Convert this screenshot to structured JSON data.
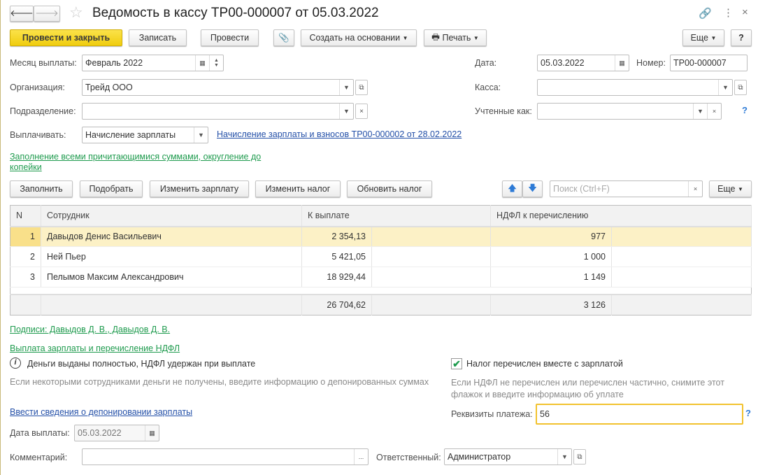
{
  "window": {
    "title": "Ведомость в кассу ТР00-000007 от 05.03.2022"
  },
  "toolbar": {
    "post_close": "Провести и закрыть",
    "save": "Записать",
    "post": "Провести",
    "create_based": "Создать на основании",
    "print": "Печать",
    "more": "Еще",
    "help": "?"
  },
  "form": {
    "month_label": "Месяц выплаты:",
    "month_value": "Февраль 2022",
    "date_label": "Дата:",
    "date_value": "05.03.2022",
    "number_label": "Номер:",
    "number_value": "ТР00-000007",
    "org_label": "Организация:",
    "org_value": "Трейд ООО",
    "cash_label": "Касса:",
    "cash_value": "",
    "dept_label": "Подразделение:",
    "dept_value": "",
    "accounted_label": "Учтенные как:",
    "accounted_value": "",
    "pay_label": "Выплачивать:",
    "pay_value": "Начисление зарплаты",
    "pay_link": "Начисление зарплаты и взносов ТР00-000002 от 28.02.2022",
    "fill_link": "Заполнение всеми причитающимися суммами, округление до копейки"
  },
  "table_toolbar": {
    "fill": "Заполнить",
    "pick": "Подобрать",
    "change_salary": "Изменить зарплату",
    "change_tax": "Изменить налог",
    "update_tax": "Обновить налог",
    "search_placeholder": "Поиск (Ctrl+F)",
    "more": "Еще"
  },
  "table": {
    "headers": [
      "N",
      "Сотрудник",
      "К выплате",
      "НДФЛ к перечислению"
    ],
    "rows": [
      {
        "n": "1",
        "name": "Давыдов Денис Васильевич",
        "pay": "2 354,13",
        "tax": "977"
      },
      {
        "n": "2",
        "name": "Ней Пьер",
        "pay": "5 421,05",
        "tax": "1 000"
      },
      {
        "n": "3",
        "name": "Пелымов Максим Александрович",
        "pay": "18 929,44",
        "tax": "1 149"
      }
    ],
    "totals": {
      "pay": "26 704,62",
      "tax": "3 126"
    }
  },
  "bottom": {
    "signatures_link": "Подписи: Давыдов Д. В., Давыдов Д. В.",
    "payment_link": "Выплата зарплаты и перечисление НДФЛ",
    "info_text": "Деньги выданы полностью, НДФЛ удержан при выплате",
    "info_hint": "Если некоторыми сотрудниками деньги не получены, введите информацию о депонированных суммах",
    "deposit_link": "Ввести сведения о депонировании зарплаты",
    "tax_checkbox_label": "Налог перечислен вместе с зарплатой",
    "tax_checked": true,
    "tax_hint": "Если НДФЛ не перечислен или перечислен частично, снимите этот флажок и введите информацию об уплате",
    "requisites_label": "Реквизиты платежа:",
    "requisites_value": "56",
    "pay_date_label": "Дата выплаты:",
    "pay_date_value": "05.03.2022",
    "comment_label": "Комментарий:",
    "comment_value": "",
    "responsible_label": "Ответственный:",
    "responsible_value": "Администратор"
  }
}
